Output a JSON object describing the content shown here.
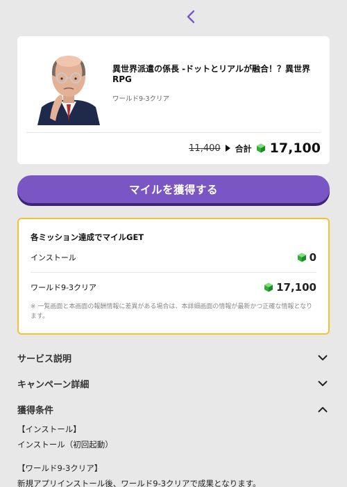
{
  "header": {
    "back_icon": "chevron-left-icon",
    "accent": "#7a56c4"
  },
  "offer": {
    "title": "異世界派遣の係長 -ドットとリアルが融合！？異世界RPG",
    "subtitle": "ワールド9-3クリア",
    "old_price": "11,400",
    "total_label": "合計",
    "total_value": "17,100"
  },
  "cta": {
    "label": "マイルを獲得する",
    "color": "#7a56c4"
  },
  "missions": {
    "heading": "各ミッション達成でマイルGET",
    "items": [
      {
        "label": "インストール",
        "reward": "0"
      },
      {
        "label": "ワールド9-3クリア",
        "reward": "17,100"
      }
    ],
    "note": "※ 一覧画面と本画面の報酬情報に差異がある場合は、本詳細画面の情報が最新かつ正確な情報となります。",
    "border_color": "#f2c230"
  },
  "sections": [
    {
      "title": "サービス説明",
      "expanded": false
    },
    {
      "title": "キャンペーン詳細",
      "expanded": false
    },
    {
      "title": "獲得条件",
      "expanded": true
    }
  ],
  "conditions": {
    "install_heading": "【インストール】",
    "install_text": "インストール（初回起動）",
    "clear_heading": "【ワールド9-3クリア】",
    "clear_text": "新規アプリインストール後、ワールド9-3クリアで成果となります。"
  }
}
